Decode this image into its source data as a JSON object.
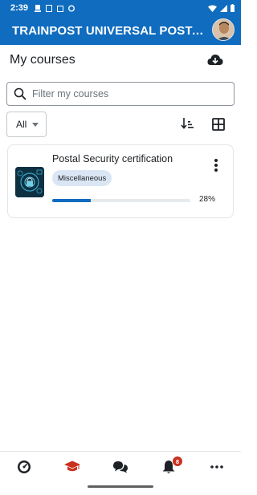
{
  "status_bar": {
    "time": "2:39"
  },
  "app": {
    "title": "TRAINPOST UNIVERSAL POSTA..."
  },
  "page": {
    "title": "My courses"
  },
  "search": {
    "placeholder": "Filter my courses"
  },
  "filter": {
    "selected": "All"
  },
  "courses": [
    {
      "name": "Postal Security certification",
      "category": "Miscellaneous",
      "progress_percent": 28,
      "progress_label": "28%"
    }
  ],
  "bottom_nav": {
    "items": [
      "dashboard-icon",
      "graduation-cap-icon",
      "chat-bubbles-icon",
      "bell-icon",
      "more-icon"
    ],
    "notification_count": "8",
    "active_color": "#ca3120"
  },
  "colors": {
    "brand": "#0f6cbf",
    "badge_bg": "#dbe6f4"
  }
}
